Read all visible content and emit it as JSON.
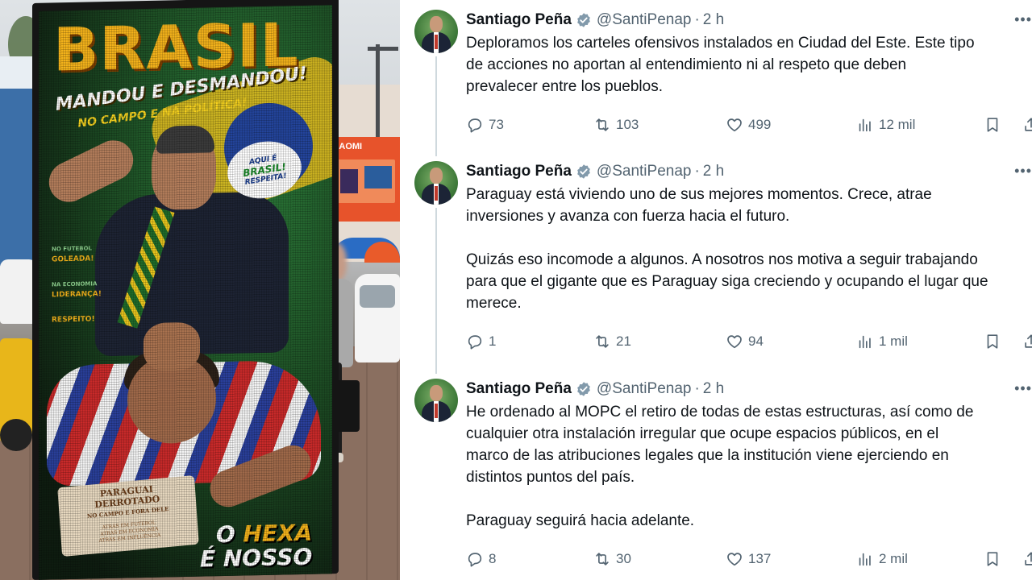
{
  "photo": {
    "poster": {
      "title": "BRASIL",
      "subtitle": "MANDOU E DESMANDOU!",
      "tagline": "NO CAMPO E NA POLÍTICA!",
      "speech_line1": "AQUI É",
      "speech_line2": "BRASIL!",
      "speech_line3": "RESPEITA!",
      "check1_small": "NO FUTEBOL",
      "check1": "GOLEADA!",
      "check2_small": "NA ECONOMIA",
      "check2": "LIDERANÇA!",
      "check3": "RESPEITO!",
      "scroll_title": "PARAGUAI DERROTADO",
      "scroll_sub": "NO CAMPO E FORA DELE",
      "scroll_lines": [
        "ATRÁS EM FUTEBOL",
        "ATRÁS EM ECONOMIA",
        "ATRÁS EM INFLUÊNCIA"
      ],
      "hexa_line1_a": "O ",
      "hexa_line1_b": "HEXA",
      "hexa_line2": "É NOSSO"
    },
    "shop_sign": "XIAOMI"
  },
  "tweets": [
    {
      "name": "Santiago Peña",
      "handle": "@SantiPenap",
      "separator": "·",
      "time": "2 h",
      "paragraphs": [
        [
          "Deploramos los carteles ofensivos instalados en Ciudad del Este. Este tipo",
          "de acciones no aportan al entendimiento ni al respeto que deben",
          "prevalecer entre los pueblos."
        ]
      ],
      "replies": "73",
      "reposts": "103",
      "likes": "499",
      "views": "12 mil"
    },
    {
      "name": "Santiago Peña",
      "handle": "@SantiPenap",
      "separator": "·",
      "time": "2 h",
      "paragraphs": [
        [
          "Paraguay está viviendo uno de sus mejores momentos. Crece, atrae",
          "inversiones y avanza con fuerza hacia el futuro."
        ],
        [
          "Quizás eso incomode a algunos. A nosotros nos motiva a seguir trabajando",
          "para que el gigante que es Paraguay siga creciendo y ocupando el lugar que",
          "merece."
        ]
      ],
      "replies": "1",
      "reposts": "21",
      "likes": "94",
      "views": "1 mil"
    },
    {
      "name": "Santiago Peña",
      "handle": "@SantiPenap",
      "separator": "·",
      "time": "2 h",
      "paragraphs": [
        [
          "He ordenado al MOPC el retiro de todas de estas estructuras, así como de",
          "cualquier otra instalación irregular que ocupe espacios públicos, en el",
          "marco de las atribuciones legales que la institución viene ejerciendo en",
          "distintos puntos del país."
        ],
        [
          "Paraguay seguirá hacia adelante."
        ]
      ],
      "replies": "8",
      "reposts": "30",
      "likes": "137",
      "views": "2 mil"
    }
  ],
  "icons": {
    "reply": "reply-icon",
    "repost": "repost-icon",
    "like": "heart-icon",
    "views": "views-chart-icon",
    "bookmark": "bookmark-icon",
    "share": "share-icon",
    "verified": "verified-badge-icon",
    "more": "more-icon"
  },
  "colors": {
    "text": "#0f1419",
    "secondary": "#536471",
    "verified": "#829aab",
    "thread_line": "#cfd9de"
  }
}
